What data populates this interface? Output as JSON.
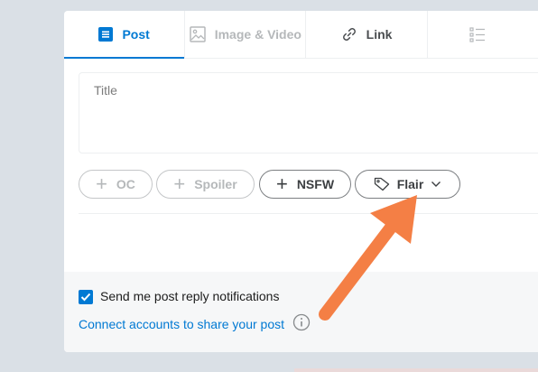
{
  "tabs": [
    {
      "label": "Post",
      "icon": "post-icon"
    },
    {
      "label": "Image & Video",
      "icon": "image-icon"
    },
    {
      "label": "Link",
      "icon": "link-icon"
    },
    {
      "label": "",
      "icon": "poll-icon"
    }
  ],
  "title_input": {
    "placeholder": "Title"
  },
  "tags": {
    "oc_label": "OC",
    "spoiler_label": "Spoiler",
    "nsfw_label": "NSFW",
    "flair_label": "Flair"
  },
  "footer": {
    "notify_label": "Send me post reply notifications",
    "notify_checked": true,
    "connect_label": "Connect accounts to share your post"
  },
  "colors": {
    "accent": "#0079d3",
    "annotation_arrow": "#f47f45",
    "background": "#dae0e6"
  }
}
